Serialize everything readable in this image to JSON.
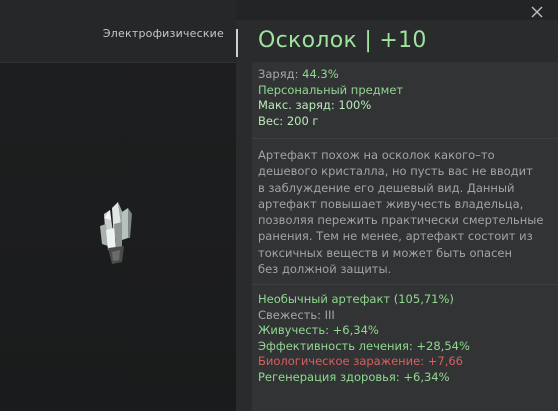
{
  "category": "Электрофизические",
  "item": {
    "title": "Осколок | +10"
  },
  "stats": [
    {
      "label": "Заряд:",
      "value": "44.3%"
    },
    {
      "label": "Персональный предмет",
      "value": ""
    },
    {
      "label": "Макс. заряд:",
      "value": "100%"
    },
    {
      "label": "Вес:",
      "value": "200 г"
    }
  ],
  "description_lines": [
    "Артефакт похож на осколок какого–то",
    "дешевого кристалла, но пусть вас не вводит",
    "в заблуждение его дешевый вид. Данный",
    "артефакт повышает живучесть владельца,",
    "позволяя пережить практически смертельные",
    "ранения. Тем не менее, артефакт состоит из",
    "токсичных веществ и может быть опасен",
    "без должной защиты."
  ],
  "properties": {
    "rarity": "Необычный артефакт (105,71%)",
    "freshness": "Свежесть: III",
    "vitality": "Живучесть: +6,34%",
    "healing_efficiency": "Эффективность лечения: +28,54%",
    "bio_infection": "Биологическое заражение: +7,66",
    "health_regen": "Регенерация здоровья: +6,34%"
  },
  "icons": {
    "close": "close-icon",
    "artifact": "crystal-artifact-icon"
  },
  "colors": {
    "title": "#9fe39f",
    "positive": "#8fd98f",
    "negative": "#d95f5f",
    "neutral": "#a7a7a7"
  }
}
